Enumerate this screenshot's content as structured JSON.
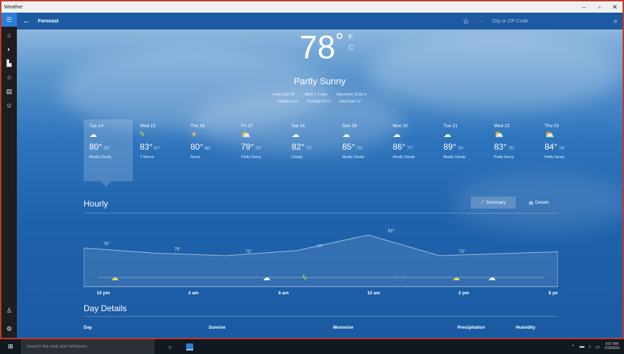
{
  "window": {
    "title": "Weather",
    "controls": [
      "–",
      "▫",
      "✕"
    ]
  },
  "sidebar": {
    "top_icons": [
      "menu-icon",
      "home-icon",
      "maps-icon",
      "historical-weather-icon",
      "favorites-icon",
      "news-icon",
      "feedback-icon"
    ],
    "bottom_icons": [
      "account-icon",
      "settings-icon"
    ]
  },
  "appbar": {
    "back": "←",
    "title": "Forecast",
    "star": "☆",
    "more": "···",
    "search_placeholder": "City or ZIP Code"
  },
  "current": {
    "temp": "78",
    "degree": "°",
    "unit_f": "F",
    "unit_c": "C",
    "condition": "Partly Sunny",
    "stats_row1": [
      "Feels Like 78°",
      "Wind ➘ 9 mph",
      "Barometer 29.56 in"
    ],
    "stats_row2": [
      "Visibility 9 mi",
      "Humidity 87 %",
      "Dew Point 71°"
    ]
  },
  "days": [
    {
      "name": "Tue 14",
      "icon": "☁",
      "hi": "80°",
      "lo": "75°",
      "cond": "Mostly Cloudy",
      "selected": true
    },
    {
      "name": "Wed 15",
      "icon": "ϟ",
      "hi": "83°",
      "lo": "67°",
      "cond": "T-Storms"
    },
    {
      "name": "Thu 16",
      "icon": "☀",
      "hi": "80°",
      "lo": "68°",
      "cond": "Sunny"
    },
    {
      "name": "Fri 17",
      "icon": "⛅",
      "hi": "79°",
      "lo": "73°",
      "cond": "Partly Sunny"
    },
    {
      "name": "Sat 18",
      "icon": "☁",
      "hi": "82°",
      "lo": "72°",
      "cond": "Cloudy"
    },
    {
      "name": "Sun 19",
      "icon": "☁",
      "hi": "85°",
      "lo": "73°",
      "cond": "Mostly Cloudy"
    },
    {
      "name": "Mon 20",
      "icon": "☁",
      "hi": "86°",
      "lo": "77°",
      "cond": "Mostly Cloudy"
    },
    {
      "name": "Tue 21",
      "icon": "☁",
      "hi": "89°",
      "lo": "74°",
      "cond": "Mostly Cloudy"
    },
    {
      "name": "Wed 22",
      "icon": "⛅",
      "hi": "83°",
      "lo": "75°",
      "cond": "Partly Sunny"
    },
    {
      "name": "Thu 23",
      "icon": "⛅",
      "hi": "84°",
      "lo": "74°",
      "cond": "Partly Sunny"
    }
  ],
  "hourly": {
    "title": "Hourly",
    "summary_label": "Summary",
    "details_label": "Details",
    "temp_labels": [
      {
        "hour": 0,
        "label": "78°",
        "value": 78
      },
      {
        "hour": 3,
        "label": "76°",
        "value": 76
      },
      {
        "hour": 6,
        "label": "75°",
        "value": 75
      },
      {
        "hour": 9,
        "label": "77°",
        "value": 77
      },
      {
        "hour": 12,
        "label": "83°",
        "value": 83
      },
      {
        "hour": 15,
        "label": "75°",
        "value": 75
      }
    ],
    "icons": [
      {
        "hour": 0.6,
        "icon": "☁",
        "name": "partly-cloudy-night-icon",
        "color": "#ffd34d"
      },
      {
        "hour": 7.0,
        "icon": "☁",
        "name": "cloudy-icon",
        "color": "#ffffff"
      },
      {
        "hour": 8.6,
        "icon": "ϟ",
        "name": "thunderstorm-icon",
        "color": "#d4ec3a"
      },
      {
        "hour": 12.6,
        "icon": "⋮⋮",
        "name": "rain-icon",
        "color": "#59b8f0"
      },
      {
        "hour": 15.0,
        "icon": "☁",
        "name": "partly-sunny-icon",
        "color": "#ffd34d"
      },
      {
        "hour": 16.5,
        "icon": "☁",
        "name": "cloudy-icon-2",
        "color": "#ffffff"
      }
    ],
    "hour_labels": [
      {
        "hour": 0,
        "label": "10 pm"
      },
      {
        "hour": 4,
        "label": "2 am"
      },
      {
        "hour": 8,
        "label": "6 am"
      },
      {
        "hour": 12,
        "label": "10 am"
      },
      {
        "hour": 16,
        "label": "2 pm"
      },
      {
        "hour": 20,
        "label": "6 pm"
      }
    ]
  },
  "day_details": {
    "title": "Day Details",
    "columns": [
      "Day",
      "Sunrise",
      "Moonrise",
      "Precipitation",
      "Humidity"
    ]
  },
  "taskbar": {
    "search_placeholder": "Search the web and Windows",
    "time": "9:57 AM",
    "date": "7/15/2015"
  },
  "colors": {
    "accent": "#2a7dd6",
    "frame": "#c0392b"
  }
}
